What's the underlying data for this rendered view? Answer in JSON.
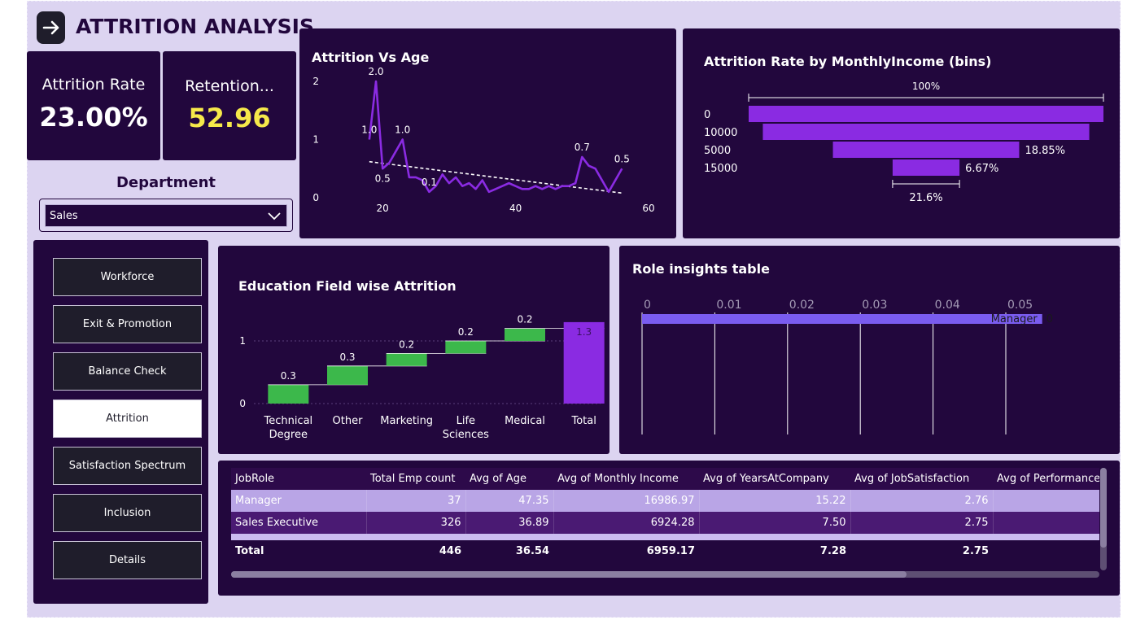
{
  "header": {
    "title": "ATTRITION ANALYSIS",
    "back_icon": "arrow-right-icon"
  },
  "kpis": {
    "attrition": {
      "label": "Attrition Rate",
      "value": "23.00%"
    },
    "retention": {
      "label": "Retention...",
      "value": "52.96",
      "value_color": "#f6e94a"
    }
  },
  "filter": {
    "label": "Department",
    "selected": "Sales"
  },
  "nav": {
    "items": [
      "Workforce",
      "Exit & Promotion",
      "Balance Check",
      "Attrition",
      "Satisfaction Spectrum",
      "Inclusion",
      "Details"
    ],
    "active": "Attrition"
  },
  "age_chart": {
    "title": "Attrition Vs Age",
    "chart_data": {
      "type": "line",
      "x": [
        18,
        19,
        20,
        21,
        22,
        23,
        24,
        25,
        26,
        27,
        28,
        29,
        30,
        31,
        32,
        33,
        34,
        35,
        36,
        37,
        38,
        39,
        40,
        41,
        42,
        43,
        44,
        45,
        46,
        47,
        48,
        49,
        50,
        51,
        52,
        53,
        54,
        55,
        56
      ],
      "y": [
        1.0,
        2.0,
        0.5,
        0.6,
        0.8,
        1.0,
        0.35,
        0.35,
        0.3,
        0.1,
        0.2,
        0.4,
        0.25,
        0.35,
        0.2,
        0.25,
        0.15,
        0.3,
        0.1,
        0.15,
        0.2,
        0.25,
        0.2,
        0.15,
        0.15,
        0.2,
        0.15,
        0.2,
        0.15,
        0.2,
        0.2,
        0.25,
        0.7,
        0.55,
        0.5,
        0.3,
        0.1,
        0.3,
        0.5
      ],
      "data_labels": [
        {
          "x": 18,
          "text": "1.0"
        },
        {
          "x": 19,
          "text": "2.0"
        },
        {
          "x": 20,
          "text": "0.5"
        },
        {
          "x": 23,
          "text": "1.0"
        },
        {
          "x": 27,
          "text": "0.1"
        },
        {
          "x": 50,
          "text": "0.7"
        },
        {
          "x": 56,
          "text": "0.5"
        }
      ],
      "trendline": {
        "from": [
          18,
          0.62
        ],
        "to": [
          56,
          0.08
        ],
        "style": "dashed"
      },
      "x_ticks": [
        20,
        40,
        60
      ],
      "xlim": [
        13,
        60
      ],
      "y_ticks": [
        0,
        1,
        2
      ],
      "ylim": [
        0,
        2
      ],
      "color": "#8a2be2",
      "grid": false
    }
  },
  "income_chart": {
    "title": "Attrition Rate by MonthlyIncome (bins)",
    "chart_data": {
      "type": "bar",
      "subtype": "funnel",
      "categories": [
        "0",
        "10000",
        "5000",
        "15000"
      ],
      "values": [
        100,
        92,
        52.5,
        18.85
      ],
      "labels": [
        "",
        "",
        "18.85%",
        "6.67%"
      ],
      "top_label": "100%",
      "bottom_label": "21.6%",
      "color": "#8a2be2"
    }
  },
  "edu_chart": {
    "title": "Education Field wise Attrition",
    "chart_data": {
      "type": "bar",
      "subtype": "waterfall",
      "categories": [
        "Technical Degree",
        "Other",
        "Marketing",
        "Life Sciences",
        "Medical",
        "Total"
      ],
      "category_lines": [
        [
          "Technical",
          "Degree"
        ],
        [
          "Other"
        ],
        [
          "Marketing"
        ],
        [
          "Life",
          "Sciences"
        ],
        [
          "Medical"
        ],
        [
          "Total"
        ]
      ],
      "values": [
        0.3,
        0.3,
        0.2,
        0.2,
        0.2,
        1.3
      ],
      "labels": [
        "0.3",
        "0.3",
        "0.2",
        "0.2",
        "0.2",
        "1.3"
      ],
      "y_ticks": [
        0,
        1
      ],
      "ylim": [
        0,
        1.3
      ],
      "increase_color": "#3cb84b",
      "total_color": "#8a2be2",
      "grid": true
    }
  },
  "role_chart": {
    "title": "Role insights table",
    "chart_data": {
      "type": "bar",
      "orientation": "horizontal",
      "categories": [
        "Manager"
      ],
      "values": [
        0.055
      ],
      "value_label": "0",
      "x_ticks": [
        "0",
        "0.01",
        "0.02",
        "0.03",
        "0.04",
        "0.05"
      ],
      "xlim": [
        0,
        0.05
      ],
      "color": "#7a5cf0",
      "grid": true
    }
  },
  "table": {
    "columns": [
      "JobRole",
      "Total Emp count",
      "Avg of Age",
      "Avg of Monthly Income",
      "Avg of YearsAtCompany",
      "Avg of JobSatisfaction",
      "Avg of Performance"
    ],
    "rows": [
      [
        "Manager",
        "37",
        "47.35",
        "16986.97",
        "15.22",
        "2.76",
        ""
      ],
      [
        "Sales Executive",
        "326",
        "36.89",
        "6924.28",
        "7.50",
        "2.75",
        ""
      ]
    ],
    "total": [
      "Total",
      "446",
      "36.54",
      "6959.17",
      "7.28",
      "2.75",
      ""
    ]
  }
}
